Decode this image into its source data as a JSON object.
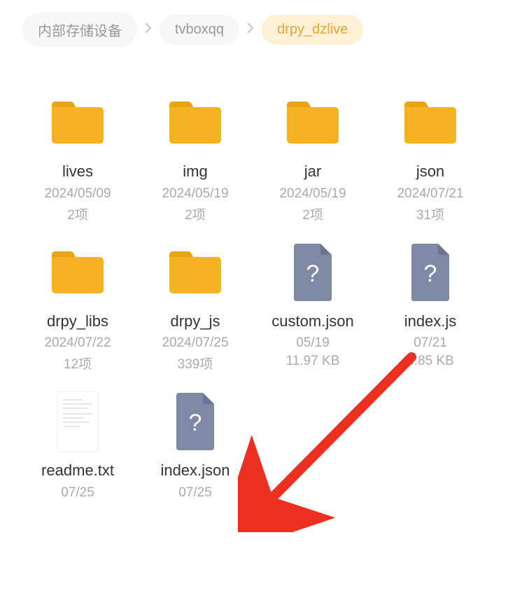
{
  "breadcrumb": {
    "items": [
      {
        "label": "内部存储设备",
        "active": false
      },
      {
        "label": "tvboxqq",
        "active": false
      },
      {
        "label": "drpy_dzlive",
        "active": true
      }
    ]
  },
  "colors": {
    "folder": "#F5B323",
    "folder_tab": "#E9A416",
    "file_unknown": "#8089A3",
    "text_doc_bg": "#FFFFFF",
    "arrow": "#EC2F1E"
  },
  "items": [
    {
      "type": "folder",
      "name": "lives",
      "date": "2024/05/09",
      "meta": "2项"
    },
    {
      "type": "folder",
      "name": "img",
      "date": "2024/05/19",
      "meta": "2项"
    },
    {
      "type": "folder",
      "name": "jar",
      "date": "2024/05/19",
      "meta": "2项"
    },
    {
      "type": "folder",
      "name": "json",
      "date": "2024/07/21",
      "meta": "31项"
    },
    {
      "type": "folder",
      "name": "drpy_libs",
      "date": "2024/07/22",
      "meta": "12项"
    },
    {
      "type": "folder",
      "name": "drpy_js",
      "date": "2024/07/25",
      "meta": "339项"
    },
    {
      "type": "file_unknown",
      "name": "custom.json",
      "date": "05/19",
      "meta": "11.97 KB"
    },
    {
      "type": "file_unknown",
      "name": "index.js",
      "date": "07/21",
      "meta": "8.85 KB"
    },
    {
      "type": "file_text",
      "name": "readme.txt",
      "date": "07/25",
      "meta": ""
    },
    {
      "type": "file_unknown",
      "name": "index.json",
      "date": "07/25",
      "meta": ""
    }
  ],
  "annotation": {
    "arrow_target": "index.json"
  }
}
